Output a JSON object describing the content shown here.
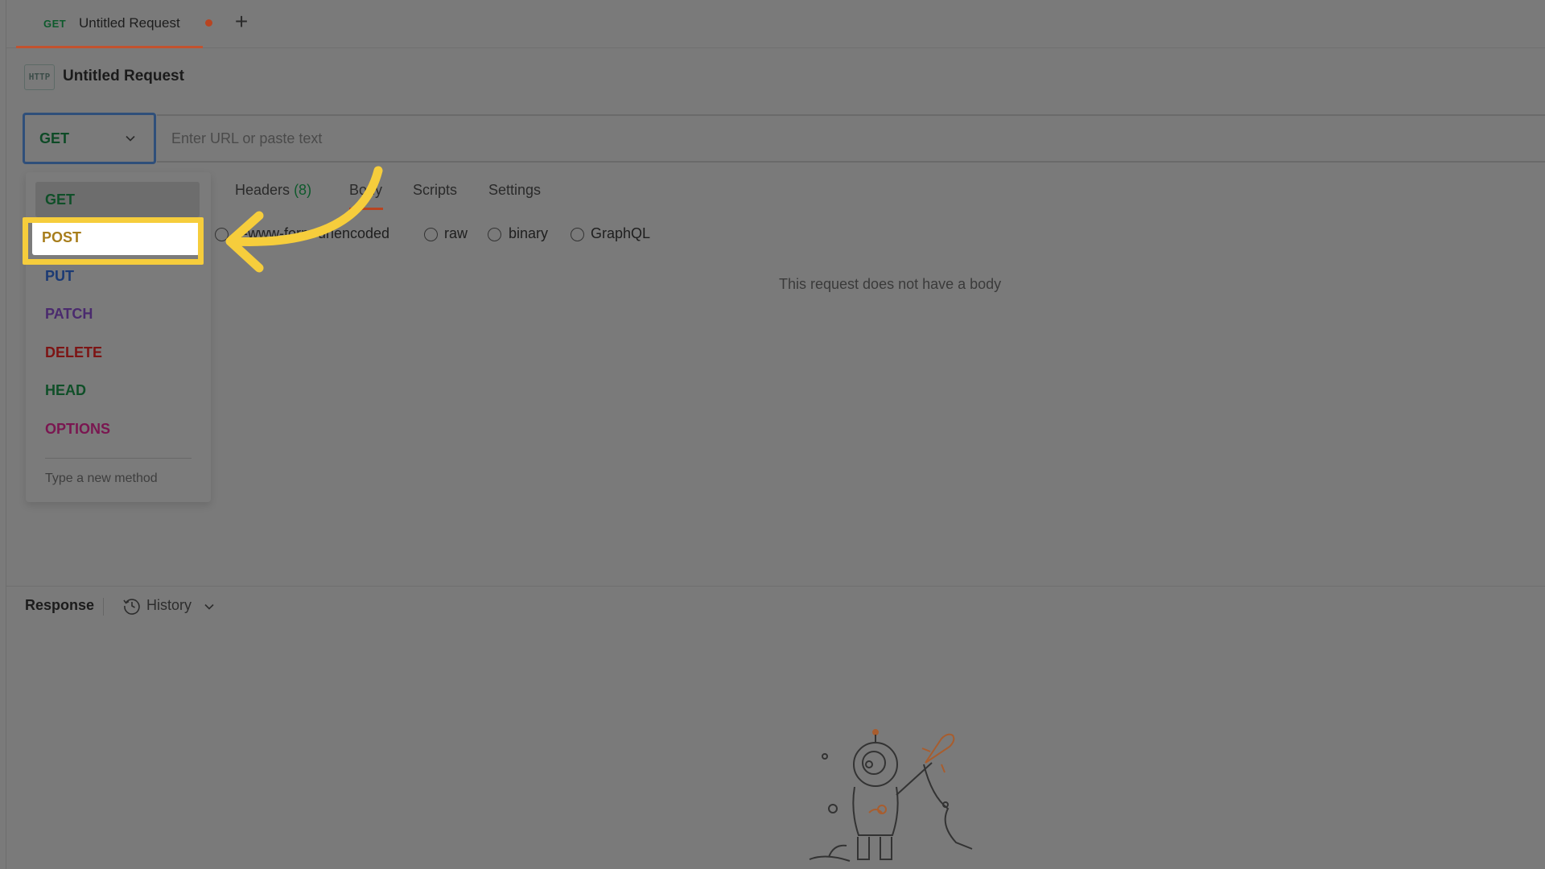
{
  "tab": {
    "method": "GET",
    "title": "Untitled Request",
    "add_label": "+"
  },
  "request": {
    "icon_text": "HTTP",
    "title": "Untitled Request",
    "method": "GET",
    "url_placeholder": "Enter URL or paste text"
  },
  "subtabs": {
    "headers_label": "Headers",
    "headers_count": "(8)",
    "body_label": "Body",
    "scripts_label": "Scripts",
    "settings_label": "Settings"
  },
  "body_types": {
    "urlencoded": "x-www-form-urlencoded",
    "raw": "raw",
    "binary": "binary",
    "graphql": "GraphQL"
  },
  "body_empty_message": "This request does not have a body",
  "method_dropdown": {
    "items": [
      "GET",
      "POST",
      "PUT",
      "PATCH",
      "DELETE",
      "HEAD",
      "OPTIONS"
    ],
    "selected": "GET",
    "highlighted": "POST",
    "new_method_placeholder": "Type a new method"
  },
  "response": {
    "label": "Response",
    "history_label": "History"
  },
  "colors": {
    "overlay_gray": "#7a7a7a",
    "tab_accent": "#b84421",
    "callout_yellow": "#f6cd3c",
    "get": "#0f4f28",
    "post": "#a77d1b",
    "put": "#1b3a74",
    "patch": "#4a2a6e",
    "delete": "#7d1414",
    "head": "#0f4f28",
    "options": "#7a1650"
  },
  "icons": {
    "http": "http-file-icon",
    "chevron": "chevron-down-icon",
    "history": "history-clock-icon",
    "callout": "curved-arrow-icon",
    "illustration": "astronaut-rocket-illustration"
  }
}
